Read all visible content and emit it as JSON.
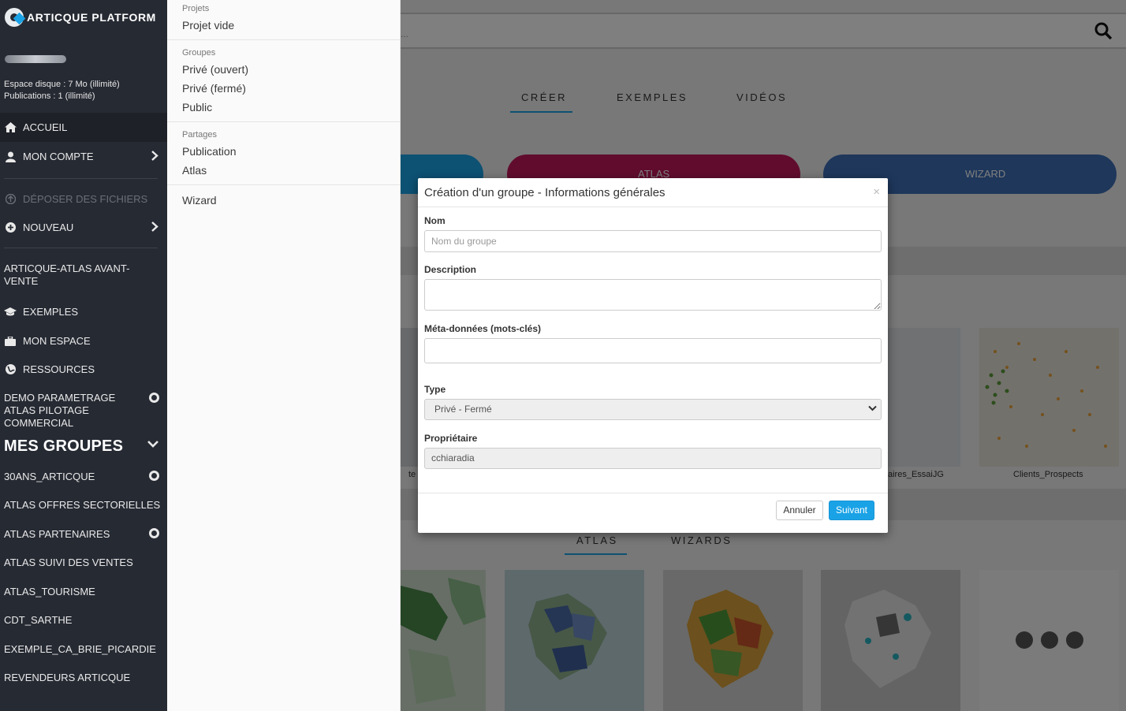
{
  "app": {
    "name": "ARTICQUE PLATFORM",
    "disk_space": "Espace disque : 7 Mo (illimité)",
    "publications": "Publications : 1 (illimité)"
  },
  "sidebar": {
    "accueil": "ACCUEIL",
    "mon_compte": "MON COMPTE",
    "deposer": "DÉPOSER DES FICHIERS",
    "nouveau": "NOUVEAU",
    "atlas_avant_vente": "ARTICQUE-ATLAS AVANT-VENTE",
    "exemples": "EXEMPLES",
    "mon_espace": "MON ESPACE",
    "ressources": "RESSOURCES",
    "demo": "DEMO PARAMETRAGE ATLAS PILOTAGE COMMERCIAL",
    "groups_title": "MES GROUPES",
    "groups": [
      "30ANS_ARTICQUE",
      "ATLAS OFFRES SECTORIELLES",
      "ATLAS PARTENAIRES",
      "ATLAS SUIVI DES VENTES",
      "ATLAS_TOURISME",
      "CDT_SARTHE",
      "EXEMPLE_CA_BRIE_PICARDIE",
      "REVENDEURS ARTICQUE"
    ]
  },
  "dropdown": {
    "projets_cat": "Projets",
    "projet_vide": "Projet vide",
    "groupes_cat": "Groupes",
    "prive_ouvert": "Privé (ouvert)",
    "prive_ferme": "Privé (fermé)",
    "public": "Public",
    "partages_cat": "Partages",
    "publication": "Publication",
    "atlas": "Atlas",
    "wizard": "Wizard"
  },
  "main": {
    "search_placeholder": "...",
    "tabs": [
      "CRÉER",
      "EXEMPLES",
      "VIDÉOS"
    ],
    "pill_atlas": "ATLAS",
    "pill_wizard": "WIZARD",
    "thumb_left_caption": "te",
    "thumb_caption_1": "aires_EssaiJG",
    "thumb_caption_2": "Clients_Prospects",
    "bottom_tabs": [
      "ATLAS",
      "WIZARDS"
    ]
  },
  "modal": {
    "title": "Création d'un groupe - Informations générales",
    "close": "×",
    "name_label": "Nom",
    "name_placeholder": "Nom du groupe",
    "description_label": "Description",
    "meta_label": "Méta-données (mots-clés)",
    "type_label": "Type",
    "type_value": "Privé - Fermé",
    "owner_label": "Propriétaire",
    "owner_value": "cchiaradia",
    "cancel": "Annuler",
    "next": "Suivant"
  },
  "colors": {
    "sidebar_bg": "#262a33",
    "accent_blue": "#1aa2e6",
    "atlas_pill": "#c2185b",
    "wizard_pill": "#3d6fb6"
  },
  "icons": [
    "articque-logo-icon",
    "home-icon",
    "user-icon",
    "chevron-right-icon",
    "upload-icon",
    "plus-circle-icon",
    "graduation-cap-icon",
    "briefcase-icon",
    "globe-icon",
    "gear-icon",
    "chevron-down-icon",
    "search-icon",
    "close-icon",
    "select-caret-icon"
  ]
}
